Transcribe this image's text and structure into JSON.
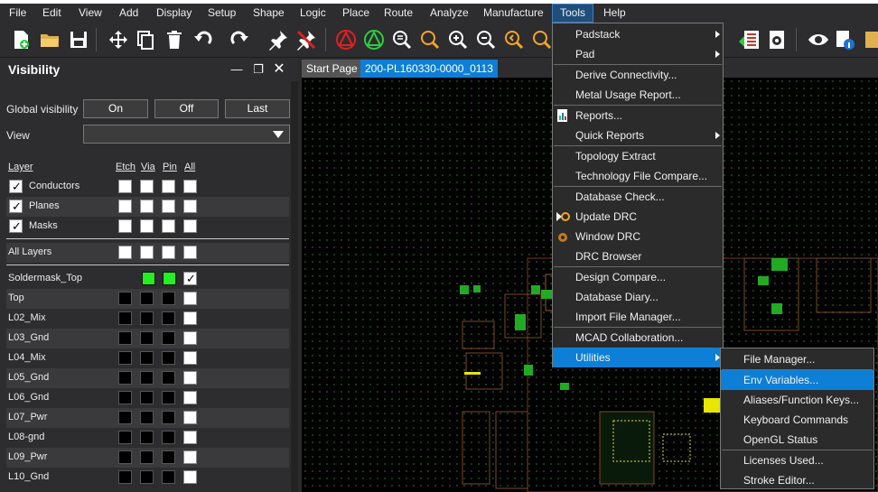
{
  "menubar": [
    "File",
    "Edit",
    "View",
    "Add",
    "Display",
    "Setup",
    "Shape",
    "Logic",
    "Place",
    "Route",
    "Analyze",
    "Manufacture",
    "Tools",
    "Help"
  ],
  "active_menu": "Tools",
  "visibility": {
    "title": "Visibility",
    "global_label": "Global visibility",
    "btn_on": "On",
    "btn_off": "Off",
    "btn_last": "Last",
    "view_label": "View",
    "view_value": "",
    "headers": {
      "layer": "Layer",
      "etch": "Etch",
      "via": "Via",
      "pin": "Pin",
      "all": "All"
    },
    "groups": [
      {
        "name": "Conductors",
        "checked": true
      },
      {
        "name": "Planes",
        "checked": true
      },
      {
        "name": "Masks",
        "checked": true
      }
    ],
    "all_layers": "All Layers",
    "layers": [
      {
        "name": "Soldermask_Top",
        "cells": [
          "none",
          "green",
          "green",
          "check"
        ]
      },
      {
        "name": "Top",
        "cells": [
          "dark",
          "dark",
          "dark",
          "white"
        ]
      },
      {
        "name": "L02_Mix",
        "cells": [
          "dark",
          "dark",
          "dark",
          "white"
        ]
      },
      {
        "name": "L03_Gnd",
        "cells": [
          "dark",
          "dark",
          "dark",
          "white"
        ]
      },
      {
        "name": "L04_Mix",
        "cells": [
          "dark",
          "dark",
          "dark",
          "white"
        ]
      },
      {
        "name": "L05_Gnd",
        "cells": [
          "dark",
          "dark",
          "dark",
          "white"
        ]
      },
      {
        "name": "L06_Gnd",
        "cells": [
          "dark",
          "dark",
          "dark",
          "white"
        ]
      },
      {
        "name": "L07_Pwr",
        "cells": [
          "dark",
          "dark",
          "dark",
          "white"
        ]
      },
      {
        "name": "L08-gnd",
        "cells": [
          "dark",
          "dark",
          "dark",
          "white"
        ]
      },
      {
        "name": "L09_Pwr",
        "cells": [
          "dark",
          "dark",
          "dark",
          "white"
        ]
      },
      {
        "name": "L10_Gnd",
        "cells": [
          "dark",
          "dark",
          "dark",
          "white"
        ]
      }
    ]
  },
  "tabs": [
    "Start Page",
    "200-PL160330-0000_0113"
  ],
  "tools_menu": [
    {
      "label": "Padstack",
      "submenu": true
    },
    {
      "label": "Pad",
      "submenu": true
    },
    {
      "label": "Derive Connectivity...",
      "submenu": false
    },
    {
      "label": "Metal Usage Report...",
      "submenu": false
    },
    {
      "label": "Reports...",
      "submenu": false,
      "icon": "report-icon"
    },
    {
      "label": "Quick Reports",
      "submenu": true
    },
    {
      "label": "Topology Extract",
      "submenu": false
    },
    {
      "label": "Technology File Compare...",
      "submenu": false
    },
    {
      "label": "Database Check...",
      "submenu": false
    },
    {
      "label": "Update DRC",
      "submenu": false,
      "icon": "update-drc-icon"
    },
    {
      "label": "Window DRC",
      "submenu": false,
      "icon": "window-drc-icon"
    },
    {
      "label": "DRC Browser",
      "submenu": false
    },
    {
      "label": "Design Compare...",
      "submenu": false
    },
    {
      "label": "Database Diary...",
      "submenu": false
    },
    {
      "label": "Import File Manager...",
      "submenu": false
    },
    {
      "label": "MCAD Collaboration...",
      "submenu": false
    },
    {
      "label": "Utilities",
      "submenu": true,
      "highlighted": true
    }
  ],
  "utilities_menu": [
    {
      "label": "File Manager..."
    },
    {
      "label": "Env Variables...",
      "highlighted": true
    },
    {
      "label": "Aliases/Function Keys..."
    },
    {
      "label": "Keyboard Commands"
    },
    {
      "label": "OpenGL Status"
    },
    {
      "label": "Licenses Used..."
    },
    {
      "label": "Stroke Editor..."
    }
  ],
  "colors": {
    "accent": "#0e7fd6",
    "active_menu": "#1f4e79",
    "panel": "#2d2d30",
    "canvas": "#000000",
    "etch_green": "#22ee22",
    "pad_yellow": "#e6e600"
  }
}
